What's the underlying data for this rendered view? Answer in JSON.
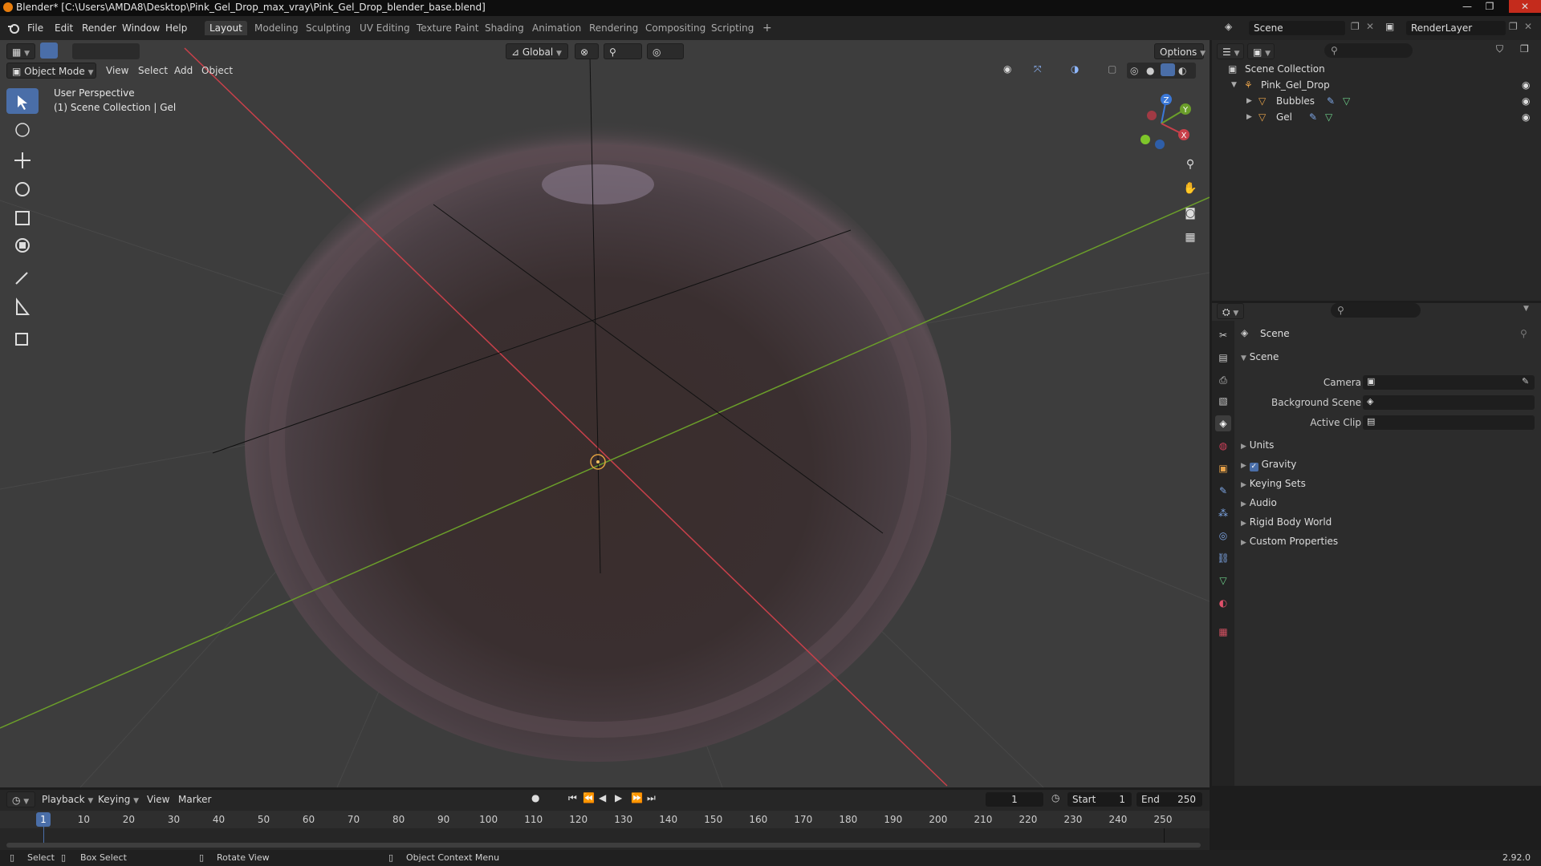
{
  "titlebar": {
    "title": "Blender* [C:\\Users\\AMDA8\\Desktop\\Pink_Gel_Drop_max_vray\\Pink_Gel_Drop_blender_base.blend]",
    "minimize": "—",
    "maximize": "❐",
    "close": "✕"
  },
  "menu": {
    "file": "File",
    "edit": "Edit",
    "render": "Render",
    "window": "Window",
    "help": "Help"
  },
  "workspaces": [
    "Layout",
    "Modeling",
    "Sculpting",
    "UV Editing",
    "Texture Paint",
    "Shading",
    "Animation",
    "Rendering",
    "Compositing",
    "Scripting"
  ],
  "workspace_add": "+",
  "scene_field": "Scene",
  "renderlayer_field": "RenderLayer",
  "viewport": {
    "mode": "Object Mode",
    "menus": {
      "view": "View",
      "select": "Select",
      "add": "Add",
      "object": "Object"
    },
    "transform_orientation": "Global",
    "options": "Options",
    "overlay_line1": "User Perspective",
    "overlay_line2": "(1) Scene Collection | Gel",
    "gizmo": {
      "z": "Z",
      "y": "Y",
      "x": "X"
    }
  },
  "outliner": {
    "root": "Scene Collection",
    "collection": "Pink_Gel_Drop",
    "objects": [
      "Bubbles",
      "Gel"
    ]
  },
  "properties": {
    "header": "Scene",
    "panel": "Scene",
    "camera_label": "Camera",
    "background_label": "Background Scene",
    "clip_label": "Active Clip",
    "sections": [
      "Units",
      "Gravity",
      "Keying Sets",
      "Audio",
      "Rigid Body World",
      "Custom Properties"
    ],
    "gravity_checked": true
  },
  "timeline": {
    "menus": {
      "playback": "Playback",
      "keying": "Keying",
      "view": "View",
      "marker": "Marker"
    },
    "current_frame": "1",
    "start_label": "Start",
    "start_value": "1",
    "end_label": "End",
    "end_value": "250",
    "ticks": [
      "1",
      "10",
      "20",
      "30",
      "40",
      "50",
      "60",
      "70",
      "80",
      "90",
      "100",
      "110",
      "120",
      "130",
      "140",
      "150",
      "160",
      "170",
      "180",
      "190",
      "200",
      "210",
      "220",
      "230",
      "240",
      "250"
    ]
  },
  "statusbar": {
    "select": "Select",
    "box_select": "Box Select",
    "rotate": "Rotate View",
    "context": "Object Context Menu",
    "version": "2.92.0"
  },
  "colors": {
    "accent": "#4a6ea8",
    "x_axis": "#c8404a",
    "y_axis": "#6b9e2a",
    "z_axis": "#3b78d8",
    "outliner_obj": "#e8a34a"
  }
}
